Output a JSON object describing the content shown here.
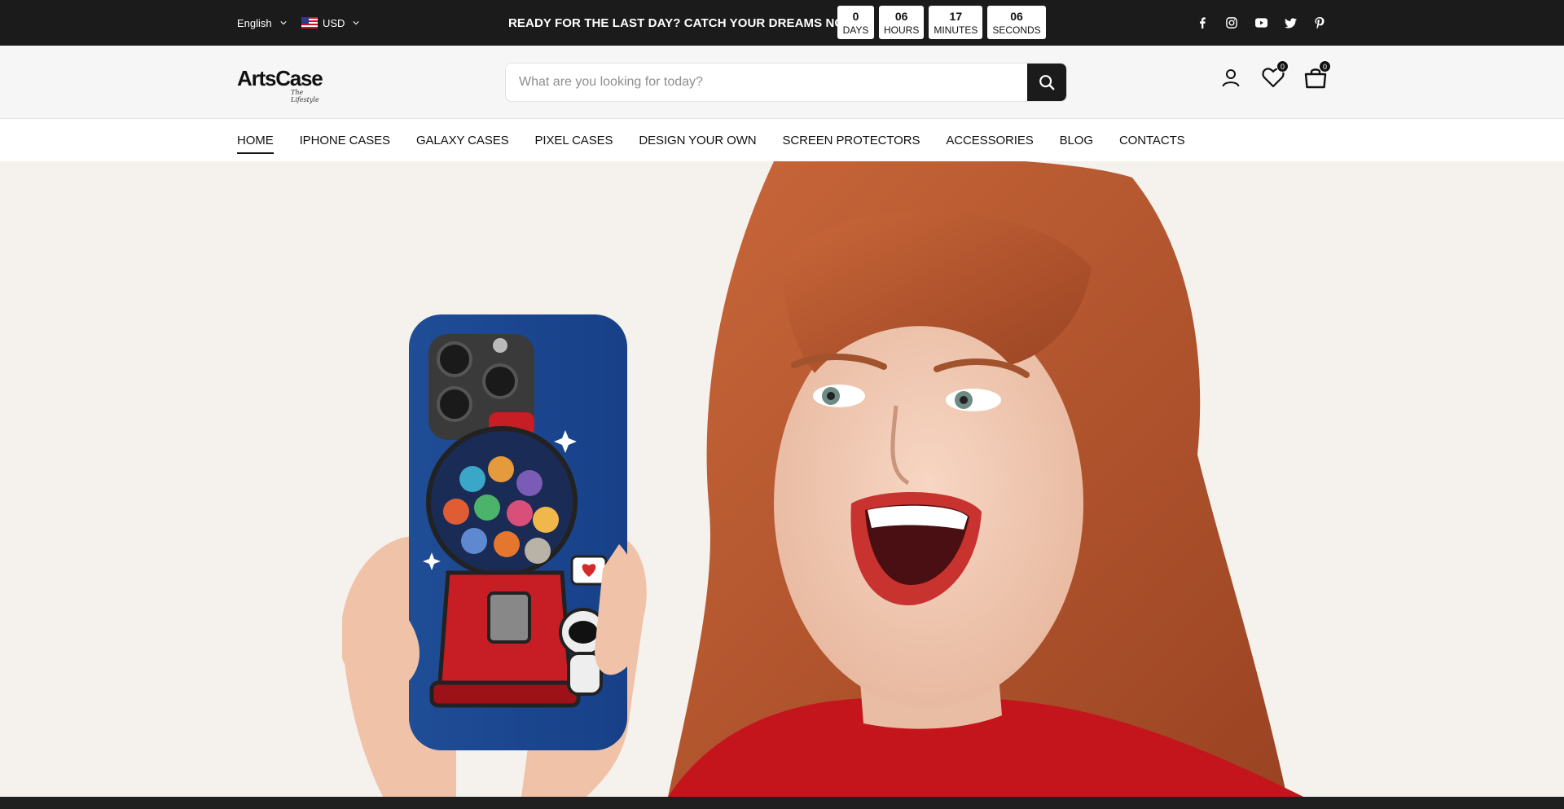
{
  "topbar": {
    "language": "English",
    "currency": "USD",
    "promo": "READY FOR THE LAST DAY? CATCH YOUR DREAMS NOW! ▯",
    "countdown": [
      {
        "value": "0",
        "label": "DAYS"
      },
      {
        "value": "06",
        "label": "HOURS"
      },
      {
        "value": "17",
        "label": "MINUTES"
      },
      {
        "value": "06",
        "label": "SECONDS"
      }
    ],
    "social": [
      "facebook-icon",
      "instagram-icon",
      "youtube-icon",
      "twitter-icon",
      "pinterest-icon"
    ]
  },
  "header": {
    "logo_text": "ArtsCase",
    "logo_tagline": "The Lifestyle",
    "search_placeholder": "What are you looking for today?",
    "wishlist_count": "0",
    "cart_count": "0"
  },
  "nav": {
    "items": [
      "HOME",
      "IPHONE CASES",
      "GALAXY CASES",
      "PIXEL CASES",
      "DESIGN YOUR OWN",
      "SCREEN PROTECTORS",
      "ACCESSORIES",
      "BLOG",
      "CONTACTS"
    ],
    "active": "HOME"
  },
  "colors": {
    "topbar_bg": "#1b1b1b",
    "header_bg": "#f6f6f6",
    "hero_bg": "#f5f1ec",
    "accent": "#111111"
  }
}
